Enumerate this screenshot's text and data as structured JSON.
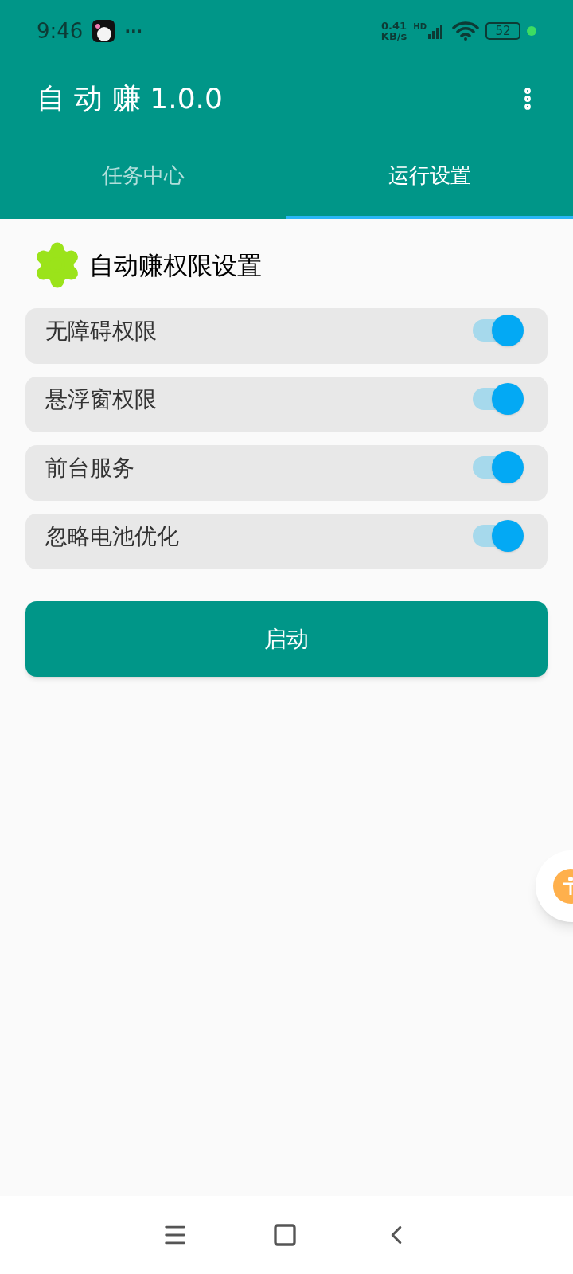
{
  "status_bar": {
    "time": "9:46",
    "more": "···",
    "speed_value": "0.41",
    "speed_unit": "KB/s",
    "network_label": "HD",
    "battery": "52"
  },
  "app_bar": {
    "title": "自 动 赚 1.0.0"
  },
  "tabs": [
    {
      "label": "任务中心",
      "selected": false
    },
    {
      "label": "运行设置",
      "selected": true
    }
  ],
  "section": {
    "title": "自动赚权限设置"
  },
  "permissions": [
    {
      "label": "无障碍权限",
      "on": true
    },
    {
      "label": "悬浮窗权限",
      "on": true
    },
    {
      "label": "前台服务",
      "on": true
    },
    {
      "label": "忽略电池优化",
      "on": true
    }
  ],
  "start_button": {
    "label": "启动"
  }
}
